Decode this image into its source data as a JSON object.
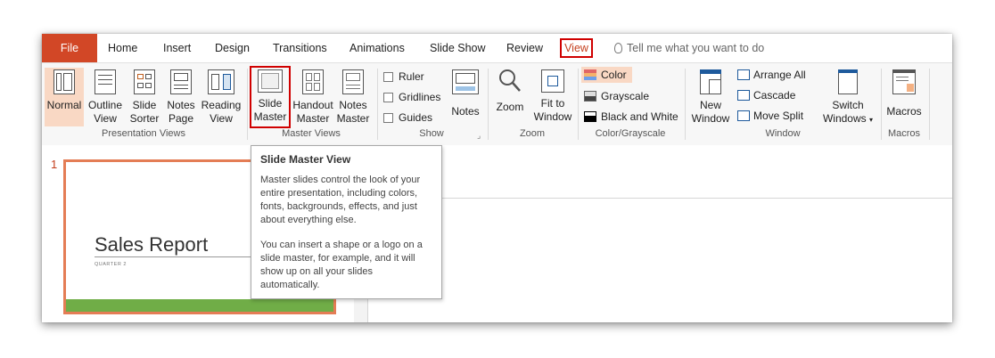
{
  "tabs": {
    "file": "File",
    "home": "Home",
    "insert": "Insert",
    "design": "Design",
    "transitions": "Transitions",
    "animations": "Animations",
    "slideshow": "Slide Show",
    "review": "Review",
    "view": "View",
    "tell_me": "Tell me what you want to do"
  },
  "presentation_views": {
    "group_label": "Presentation Views",
    "normal": "Normal",
    "outline_1": "Outline",
    "outline_2": "View",
    "sorter_1": "Slide",
    "sorter_2": "Sorter",
    "notes_1": "Notes",
    "notes_2": "Page",
    "reading_1": "Reading",
    "reading_2": "View"
  },
  "master_views": {
    "group_label": "Master Views",
    "slide_1": "Slide",
    "slide_2": "Master",
    "handout_1": "Handout",
    "handout_2": "Master",
    "notes_1": "Notes",
    "notes_2": "Master"
  },
  "show": {
    "group_label": "Show",
    "ruler": "Ruler",
    "gridlines": "Gridlines",
    "guides": "Guides",
    "notes": "Notes"
  },
  "zoom": {
    "group_label": "Zoom",
    "zoom": "Zoom",
    "fit_1": "Fit to",
    "fit_2": "Window"
  },
  "color_grayscale": {
    "group_label": "Color/Grayscale",
    "color": "Color",
    "grayscale": "Grayscale",
    "black_white": "Black and White"
  },
  "window": {
    "group_label": "Window",
    "new_1": "New",
    "new_2": "Window",
    "arrange_all": "Arrange All",
    "cascade": "Cascade",
    "move_split": "Move Split",
    "switch_1": "Switch",
    "switch_2": "Windows"
  },
  "macros": {
    "group_label": "Macros",
    "macros": "Macros"
  },
  "slide_pane": {
    "number": "1",
    "title": "Sales Report",
    "subtitle": "QUARTER 2"
  },
  "tooltip": {
    "title": "Slide Master View",
    "para1": "Master slides control the look of your entire presentation, including colors, fonts, backgrounds, effects, and just about everything else.",
    "para2": "You can insert a shape or a logo on a slide master, for example, and it will show up on all your slides automatically."
  },
  "colors": {
    "file_tab": "#d24726",
    "highlight": "#d00000",
    "selected_bg": "#f9d8c4",
    "slide_border": "#e47d55",
    "slide_bar": "#70ad47"
  }
}
